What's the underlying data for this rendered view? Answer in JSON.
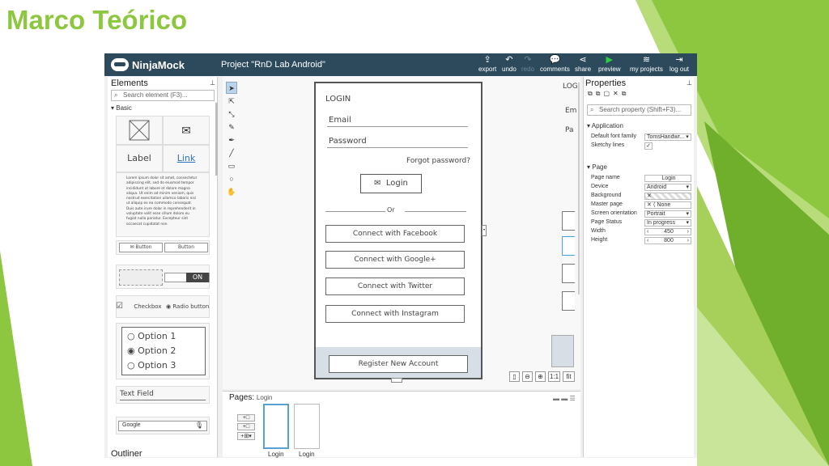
{
  "slide": {
    "title": "Marco Teórico",
    "accent": "#8dc63f"
  },
  "app": {
    "brand": "NinjaMock",
    "project_title": "Project \"RnD Lab Android\"",
    "toolbar": [
      {
        "label": "export",
        "icon": "export-icon",
        "enabled": true
      },
      {
        "label": "undo",
        "icon": "undo-icon",
        "enabled": true
      },
      {
        "label": "redo",
        "icon": "redo-icon",
        "enabled": false
      },
      {
        "label": "comments",
        "icon": "comments-icon",
        "enabled": true
      },
      {
        "label": "share",
        "icon": "share-icon",
        "enabled": true
      },
      {
        "label": "preview",
        "icon": "play-icon",
        "enabled": true
      },
      {
        "label": "my projects",
        "icon": "layers-icon",
        "enabled": true
      },
      {
        "label": "log out",
        "icon": "logout-icon",
        "enabled": true
      }
    ]
  },
  "elements_panel": {
    "title": "Elements",
    "search_placeholder": "Search element (F3)...",
    "group": "Basic",
    "items": {
      "label": "Label",
      "link": "Link",
      "lorem": "Lorem ipsum dolor sit amet, consectetur adipiscing elit, sed do eiusmod tempor incididunt ut labore et dolore magna aliqua. Ut enim ad minim veniam, quis nostrud exercitation ullamco laboris nisi ut aliquip ex ea commodo consequat. Duis aute irure dolor in reprehenderit in voluptate velit esse cillum dolore eu fugiat nulla pariatur. Excepteur sint occaecat cupidatat non",
      "button1": "Button",
      "button2": "Button",
      "toggle": "ON",
      "checkbox": "Checkbox",
      "radio": "Radio button",
      "options": [
        "Option 1",
        "Option 2",
        "Option 3"
      ],
      "selected_option": 1,
      "text_field": "Text Field",
      "search_field": "Google"
    },
    "outliner": "Outliner"
  },
  "mockup": {
    "title": "LOGIN",
    "email": "Email",
    "password": "Password",
    "forgot": "Forgot password?",
    "login_button": "Login",
    "or": "Or",
    "social": [
      "Connect with Facebook",
      "Connect with Google+",
      "Connect with Twitter",
      "Connect with Instagram"
    ],
    "register": "Register New Account",
    "ghost_title": "LOG",
    "ghost_email": "Em",
    "ghost_password": "Pa"
  },
  "zoom_controls": {
    "one_to_one": "1:1",
    "fit": "fit"
  },
  "properties_panel": {
    "title": "Properties",
    "search_placeholder": "Search property (Shift+F3)...",
    "application": {
      "title": "Application",
      "rows": [
        {
          "label": "Default font family",
          "value": "TomsHandwr..."
        },
        {
          "label": "Sketchy lines",
          "value": "✓"
        }
      ]
    },
    "page": {
      "title": "Page",
      "rows": [
        {
          "label": "Page name",
          "value": "Login"
        },
        {
          "label": "Device",
          "value": "Android"
        },
        {
          "label": "Background",
          "value": ""
        },
        {
          "label": "Master page",
          "value": "None"
        },
        {
          "label": "Screen orientation",
          "value": "Portrait"
        },
        {
          "label": "Page Status",
          "value": "In progress"
        },
        {
          "label": "Width",
          "value": "450"
        },
        {
          "label": "Height",
          "value": "800"
        }
      ]
    }
  },
  "pages_panel": {
    "label": "Pages:",
    "current": "Login",
    "thumbs": [
      "Login",
      "Login"
    ]
  }
}
